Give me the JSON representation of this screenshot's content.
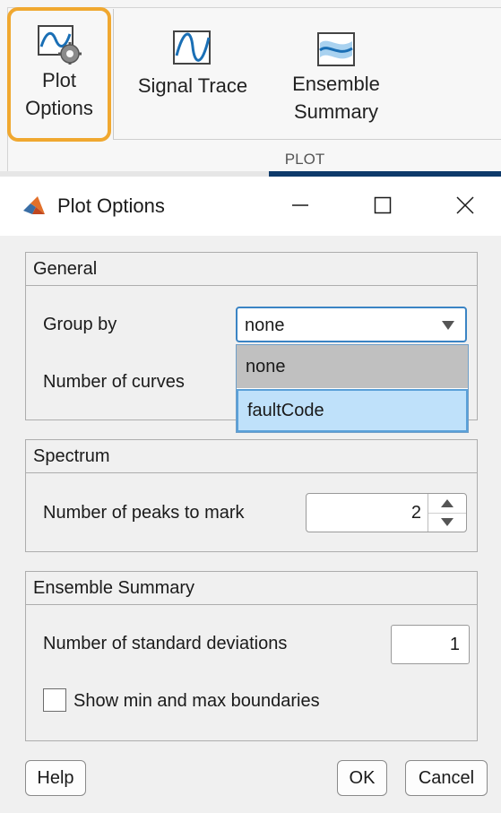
{
  "toolstrip": {
    "buttons": [
      {
        "label_line1": "Plot",
        "label_line2": "Options",
        "icon": "plot-options-gear-icon",
        "selected": true
      },
      {
        "label_line1": "Signal Trace",
        "label_line2": "",
        "icon": "signal-trace-icon"
      },
      {
        "label_line1": "Ensemble",
        "label_line2": "Summary",
        "icon": "ensemble-summary-icon"
      }
    ],
    "group_label": "PLOT",
    "highlight_color": "#f0a830"
  },
  "dialog": {
    "title": "Plot Options",
    "title_icon": "matlab-icon",
    "window_controls": [
      "minimize-icon",
      "maximize-icon",
      "close-icon"
    ],
    "general": {
      "header": "General",
      "group_by_label": "Group by",
      "group_by_value": "none",
      "group_by_options": [
        "none",
        "faultCode"
      ],
      "group_by_highlighted": "faultCode",
      "num_curves_label": "Number of curves"
    },
    "spectrum": {
      "header": "Spectrum",
      "peaks_label": "Number of peaks to mark",
      "peaks_value": "2"
    },
    "ensemble": {
      "header": "Ensemble Summary",
      "std_label": "Number of standard deviations",
      "std_value": "1",
      "minmax_label": "Show min and max boundaries",
      "minmax_checked": false
    },
    "buttons": {
      "help": "Help",
      "ok": "OK",
      "cancel": "Cancel"
    },
    "accent_color": "#3b84c4"
  }
}
